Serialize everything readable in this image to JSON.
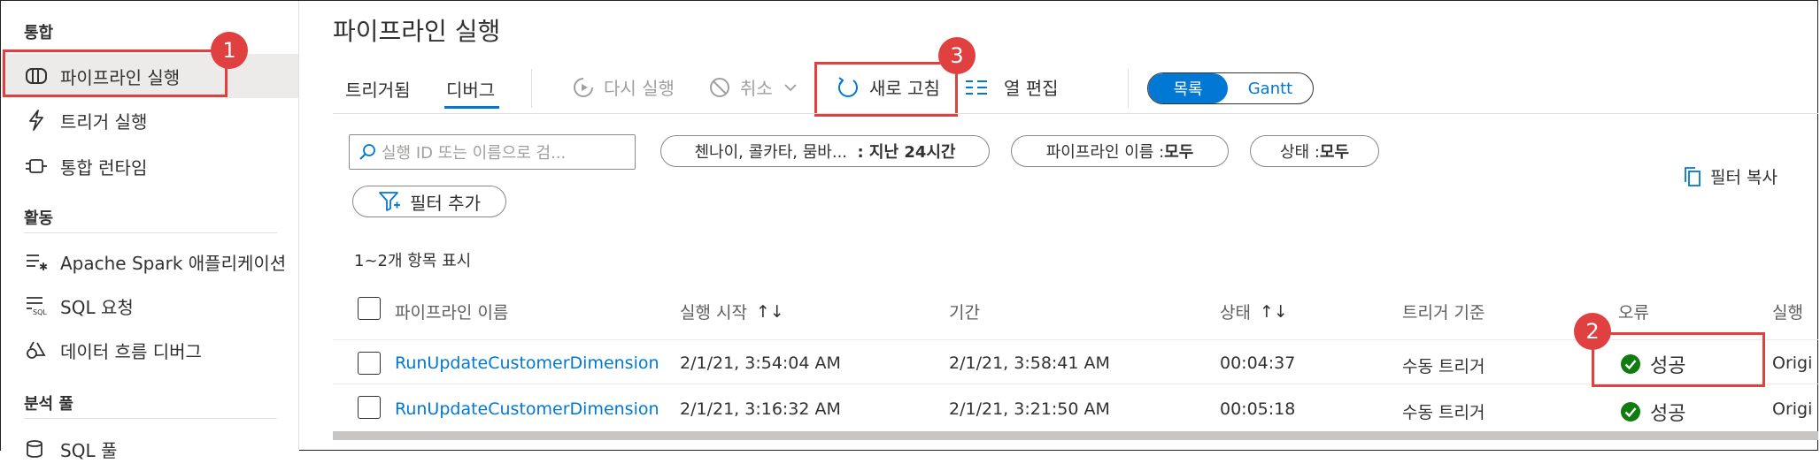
{
  "sidebar": {
    "sections": [
      {
        "title": "통합"
      },
      {
        "title": "활동"
      },
      {
        "title": "분석 풀"
      }
    ],
    "items": [
      {
        "label": "파이프라인 실행",
        "icon": "pipeline-run-icon"
      },
      {
        "label": "트리거 실행",
        "icon": "trigger-icon"
      },
      {
        "label": "통합 런타임",
        "icon": "runtime-icon"
      },
      {
        "label": "Apache Spark 애플리케이션",
        "icon": "spark-list-icon"
      },
      {
        "label": "SQL 요청",
        "icon": "sql-icon"
      },
      {
        "label": "데이터 흐름 디버그",
        "icon": "dataflow-icon"
      },
      {
        "label": "SQL 풀",
        "icon": "sql-pool-icon"
      }
    ]
  },
  "header": {
    "title": "파이프라인 실행"
  },
  "tabs": [
    {
      "label": "트리거됨"
    },
    {
      "label": "디버그"
    }
  ],
  "toolbar": {
    "rerun": "다시 실행",
    "cancel": "취소",
    "refresh": "새로 고침",
    "edit_columns": "열 편집",
    "view_list": "목록",
    "view_gantt": "Gantt"
  },
  "filters": {
    "search_placeholder": "실행 ID 또는 이름으로 검...",
    "timezone_label": "첸나이, 콜카타, 뭄바...",
    "timezone_value": ": 지난 24시간",
    "pipeline_label": "파이프라인 이름 : ",
    "pipeline_value": "모두",
    "status_label": "상태 : ",
    "status_value": "모두",
    "add_filter": "필터 추가",
    "copy_filter": "필터 복사"
  },
  "result_count": "1~2개 항목 표시",
  "table": {
    "headers": {
      "name": "파이프라인 이름",
      "start": "실행 시작",
      "duration_col": "기간",
      "status": "상태",
      "trigger": "트리거 기준",
      "error": "오류",
      "run": "실행"
    },
    "rows": [
      {
        "name": "RunUpdateCustomerDimension",
        "start": "2/1/21, 3:54:04 AM",
        "end": "2/1/21, 3:58:41 AM",
        "duration": "00:04:37",
        "trigger": "수동 트리거",
        "status": "성공",
        "run": "Origi"
      },
      {
        "name": "RunUpdateCustomerDimension",
        "start": "2/1/21, 3:16:32 AM",
        "end": "2/1/21, 3:21:50 AM",
        "duration": "00:05:18",
        "trigger": "수동 트리거",
        "status": "성공",
        "run": "Origi"
      }
    ]
  },
  "callouts": [
    "1",
    "2",
    "3"
  ],
  "colors": {
    "accent": "#0078d4",
    "success": "#107c10",
    "callout": "#e04040"
  }
}
